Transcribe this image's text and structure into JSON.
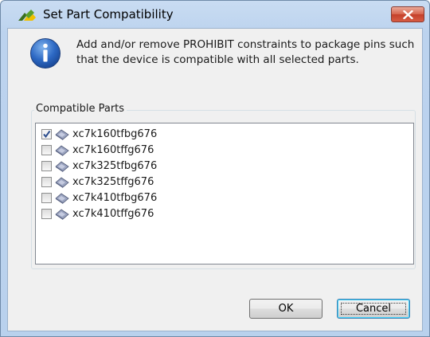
{
  "window": {
    "title": "Set Part Compatibility",
    "title_icon": "xilinx-logo-icon",
    "close_icon": "close-icon"
  },
  "message": {
    "icon": "info-icon",
    "text": "Add and/or remove PROHIBIT constraints to package pins such that the device is compatible with all selected parts."
  },
  "group": {
    "label": "Compatible Parts"
  },
  "parts": [
    {
      "label": "xc7k160tfbg676",
      "checked": true
    },
    {
      "label": "xc7k160tffg676",
      "checked": false
    },
    {
      "label": "xc7k325tfbg676",
      "checked": false
    },
    {
      "label": "xc7k325tffg676",
      "checked": false
    },
    {
      "label": "xc7k410tfbg676",
      "checked": false
    },
    {
      "label": "xc7k410tffg676",
      "checked": false
    }
  ],
  "buttons": {
    "ok": "OK",
    "cancel": "Cancel"
  }
}
